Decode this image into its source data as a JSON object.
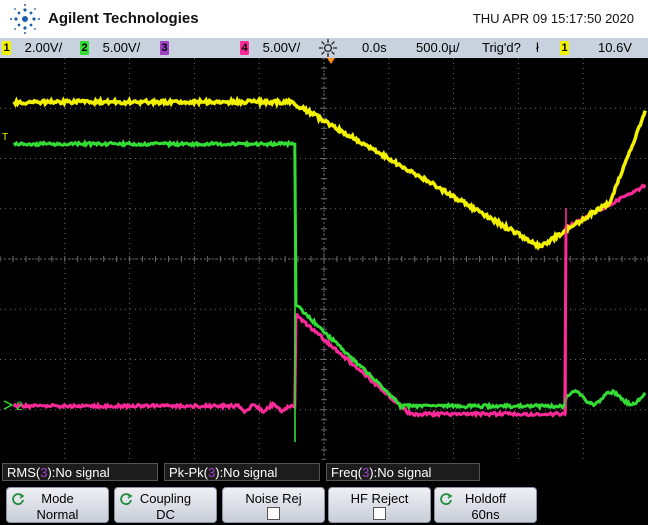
{
  "header": {
    "brand": "Agilent Technologies",
    "datetime": "THU APR 09 15:17:50 2020",
    "logo_icon": "agilent-spark-icon"
  },
  "statusbar": {
    "ch1": {
      "num": "1",
      "scale": "2.00V/",
      "color": "#f2f200"
    },
    "ch2": {
      "num": "2",
      "scale": "5.00V/",
      "color": "#33dd33"
    },
    "ch3": {
      "num": "3",
      "color": "#a040c8"
    },
    "ch4": {
      "num": "4",
      "scale": "5.00V/",
      "color": "#ff2a9a"
    },
    "acq_icon": "acquire-sun-icon",
    "delay": "0.0s",
    "timebase": "500.0µ/",
    "trigger_status": "Trig'd?",
    "trigger_edge": "ł",
    "trigger_channel": "1",
    "trigger_level": "10.6V"
  },
  "measurements": [
    {
      "label": "RMS(",
      "channel": "3",
      "tail": "):No signal"
    },
    {
      "label": "Pk-Pk(",
      "channel": "3",
      "tail": "):No signal"
    },
    {
      "label": "Freq(",
      "channel": "3",
      "tail": "):No signal"
    }
  ],
  "softkeys": [
    {
      "line1": "Mode",
      "line2": "Normal",
      "rotary": true
    },
    {
      "line1": "Coupling",
      "line2": "DC",
      "rotary": true
    },
    {
      "line1": "Noise Rej",
      "checkbox": true
    },
    {
      "line1": "HF Reject",
      "checkbox": true
    },
    {
      "line1": "Holdoff",
      "line2": "60ns",
      "rotary": true
    }
  ],
  "markers": {
    "trigger_level_marker": "T",
    "ch2_ground_marker": "2"
  },
  "colors": {
    "ch1": "#f2f200",
    "ch2": "#33dd33",
    "ch4": "#ff2a9a",
    "ch3": "#a040c8",
    "grid": "#6a6a6a"
  }
}
